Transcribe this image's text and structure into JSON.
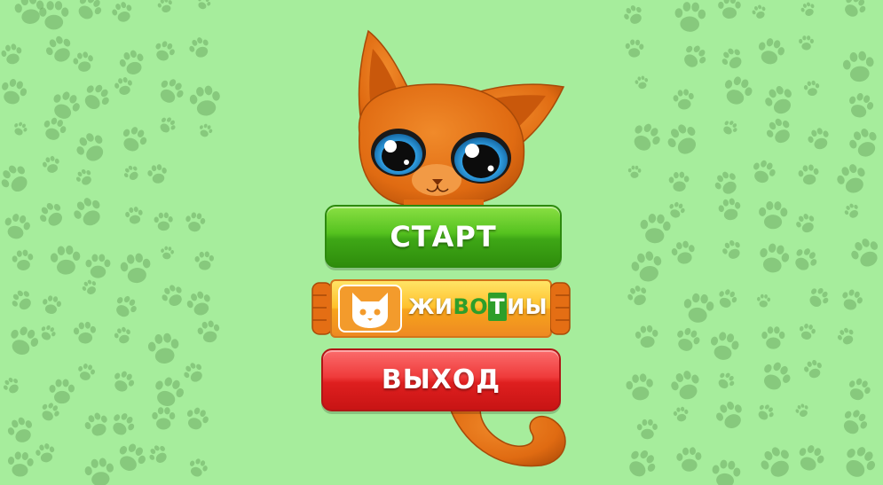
{
  "screen": "main-menu",
  "colors": {
    "background": "#a6ed9c",
    "paw": "#6fad64",
    "start_button": "#47b41a",
    "exit_button": "#e32424",
    "promo_banner": "#f9a61e",
    "cat_fur": "#e06b12"
  },
  "menu": {
    "start_label": "СТАРТ",
    "exit_label": "ВЫХОД"
  },
  "promo": {
    "icon": "cat-face-icon",
    "letters": [
      {
        "char": "Ж",
        "style": "white"
      },
      {
        "char": "И",
        "style": "white"
      },
      {
        "char": "В",
        "style": "green"
      },
      {
        "char": "О",
        "style": "green"
      },
      {
        "char": "Т",
        "style": "boxed"
      },
      {
        "char": "И",
        "style": "white"
      },
      {
        "char": "Ы",
        "style": "white"
      }
    ]
  },
  "decoration": {
    "background_pattern": "paw-print-icon",
    "mascot": "orange-cat-mascot"
  }
}
